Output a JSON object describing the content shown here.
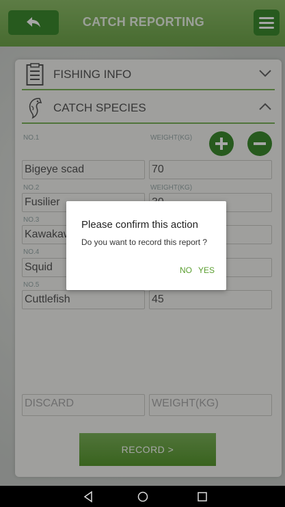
{
  "header": {
    "title": "CATCH REPORTING",
    "back_icon": "back-arrow-icon",
    "menu_icon": "hamburger-icon"
  },
  "sections": {
    "fishing_info": {
      "label": "FISHING INFO",
      "icon": "clipboard-icon",
      "chevron": "chevron-down-icon"
    },
    "catch_species": {
      "label": "CATCH SPECIES",
      "icon": "fish-icon",
      "chevron": "chevron-up-icon"
    }
  },
  "weight_header": "WEIGHT(KG)",
  "rows": [
    {
      "no": "NO.1",
      "species": "Bigeye scad",
      "weight_label": "WEIGHT(KG)",
      "weight": "70"
    },
    {
      "no": "NO.2",
      "species": "Fusilier",
      "weight_label": "WEIGHT(KG)",
      "weight": "30"
    },
    {
      "no": "NO.3",
      "species": "Kawakaw",
      "weight_label": "",
      "weight": ""
    },
    {
      "no": "NO.4",
      "species": "Squid",
      "weight_label": "",
      "weight": ""
    },
    {
      "no": "NO.5",
      "species": "Cuttlefish",
      "weight_label": "",
      "weight": "45"
    }
  ],
  "discard": {
    "placeholder": "DISCARD",
    "weight_placeholder": "WEIGHT(KG)"
  },
  "record_button": "RECORD >",
  "dialog": {
    "title": "Please confirm this action",
    "message": "Do you want to record this report ?",
    "no": "NO",
    "yes": "YES"
  },
  "colors": {
    "accent": "#3c8a2e",
    "header": "#7cb35a",
    "link": "#5a9e2f"
  }
}
